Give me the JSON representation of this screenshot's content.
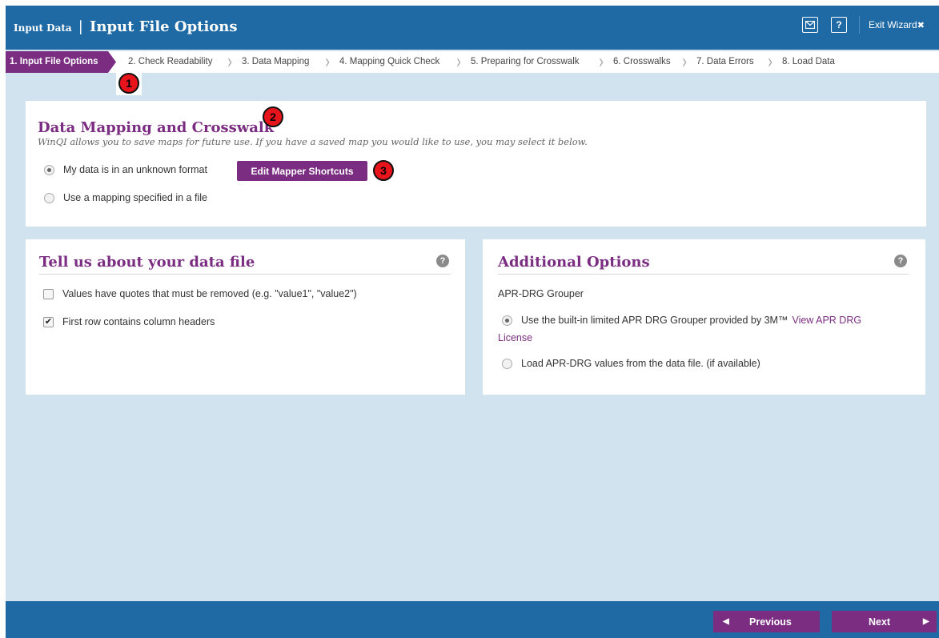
{
  "header": {
    "small_title": "Input Data",
    "separator": "|",
    "title": "Input File Options",
    "help_label": "?",
    "exit_label": "Exit Wizard",
    "exit_icon": "✖"
  },
  "steps": [
    "1. Input File Options",
    "2. Check Readability",
    "3. Data Mapping",
    "4. Mapping Quick Check",
    "5. Preparing for Crosswalk",
    "6. Crosswalks",
    "7. Data Errors",
    "8. Load Data"
  ],
  "badges": [
    "1",
    "2",
    "3"
  ],
  "mapping": {
    "title": "Data Mapping and Crosswalk",
    "subtitle": "WinQI allows you to save maps for future use. If you have a saved map you would like to use, you may select it below.",
    "option_unknown": "My data is in an unknown format",
    "edit_button": "Edit Mapper Shortcuts",
    "option_file": "Use a mapping specified in a file",
    "selected": "unknown"
  },
  "datafile": {
    "title": "Tell us about your data file",
    "help": "?",
    "quotes_label": "Values have quotes that must be removed (e.g. \"value1\", \"value2\")",
    "quotes_checked": false,
    "headers_label": "First row contains column headers",
    "headers_checked": true
  },
  "additional": {
    "title": "Additional Options",
    "help": "?",
    "grouper_label": "APR-DRG Grouper",
    "builtin_label": "Use the built-in limited APR DRG Grouper provided by 3M™",
    "license_link_line1": "View APR DRG",
    "license_link_line2": "License",
    "load_label": "Load APR-DRG values from the data file. (if available)",
    "selected": "builtin"
  },
  "footer": {
    "previous_label": "Previous",
    "next_label": "Next"
  },
  "colors": {
    "header_blue": "#1f6aa5",
    "accent_purple": "#7b2d82",
    "background": "#d0e3ee",
    "badge_red": "#e8141b"
  }
}
